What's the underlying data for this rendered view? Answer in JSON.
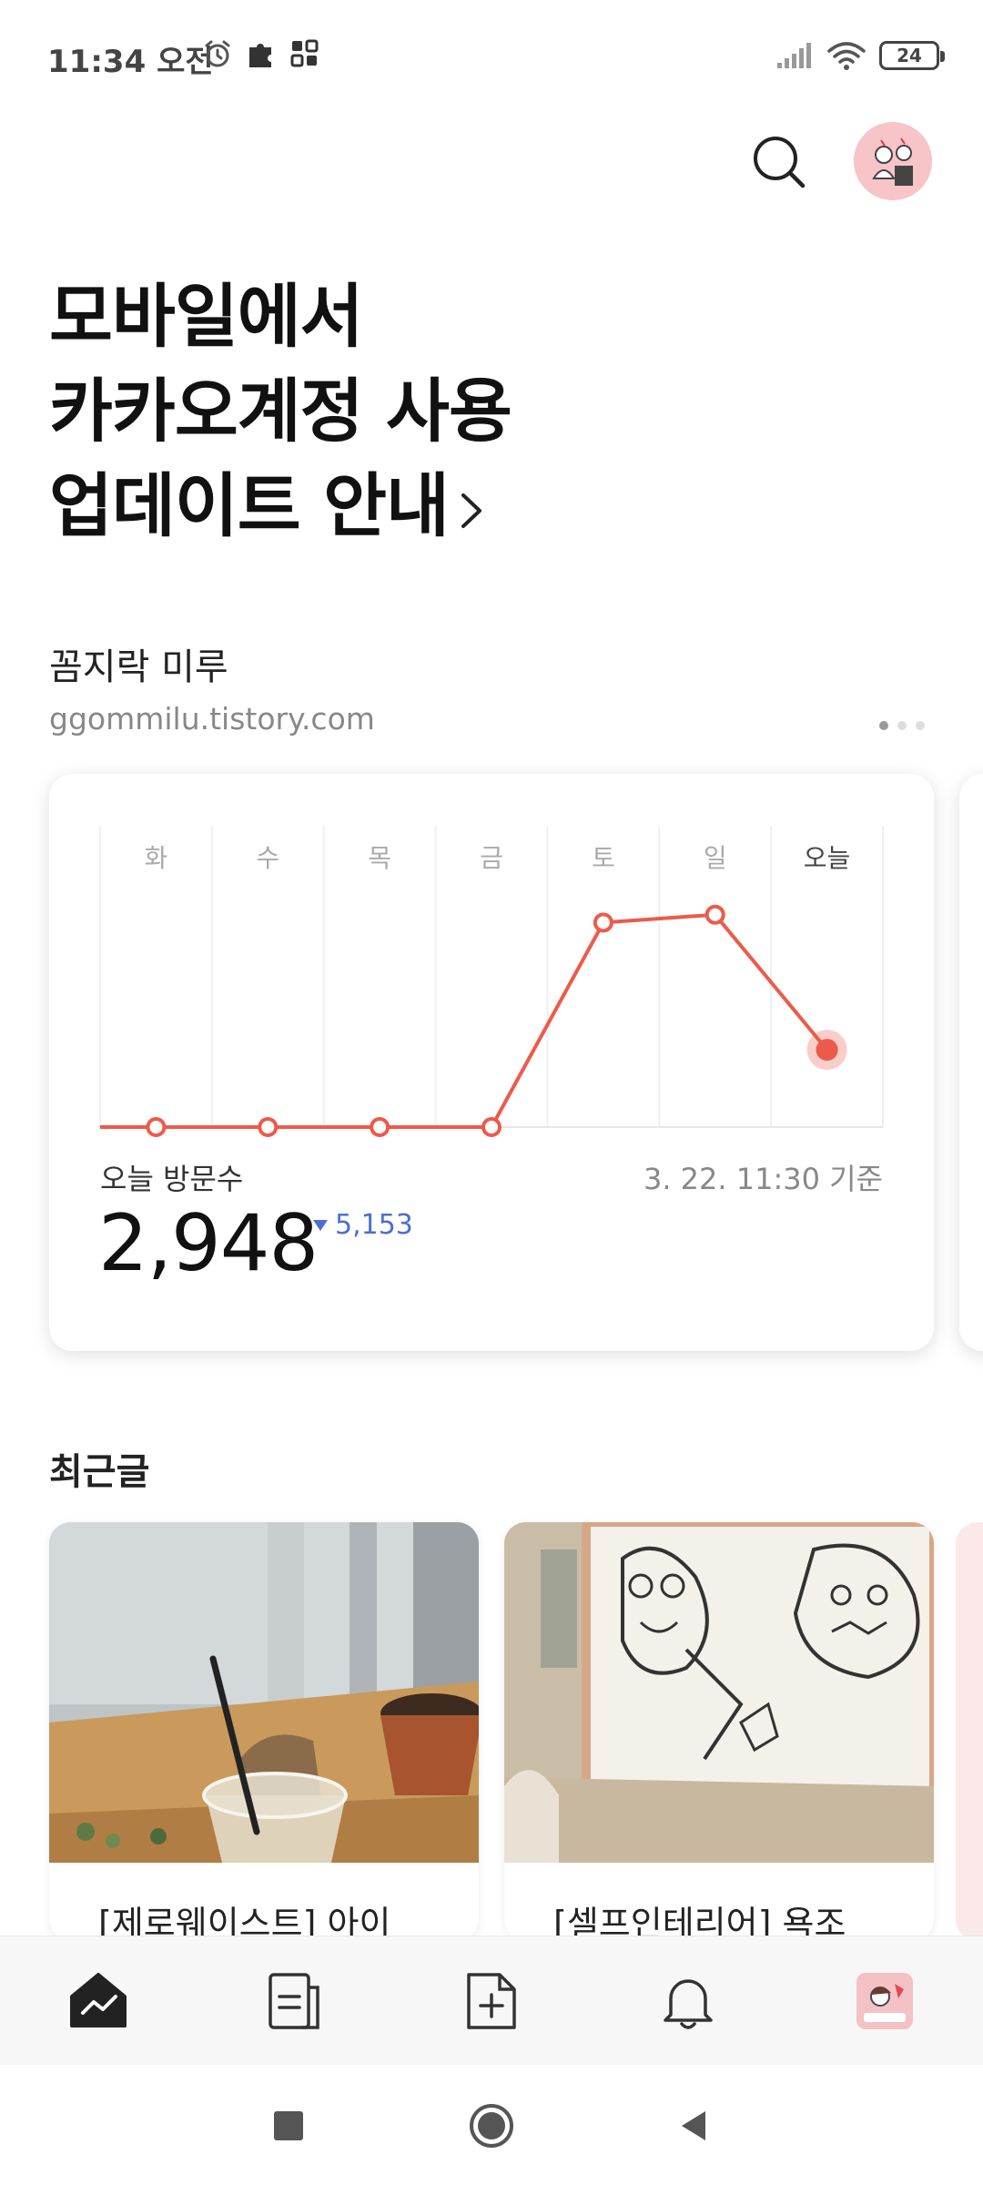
{
  "status_bar": {
    "time": "11:34 오전",
    "battery": "24"
  },
  "headline": {
    "line1": "모바일에서",
    "line2": "카카오계정 사용",
    "line3": "업데이트 안내"
  },
  "blog": {
    "name": "꼼지락 미루",
    "url": "ggommilu.tistory.com"
  },
  "stats": {
    "today_label": "오늘 방문수",
    "timestamp": "3. 22. 11:30 기준",
    "today_value": "2,948",
    "delta": "5,153",
    "delta_direction": "down",
    "delta_color": "#4a6fd3",
    "line_color": "#ec5b4a"
  },
  "chart_data": {
    "type": "line",
    "categories": [
      "화",
      "수",
      "목",
      "금",
      "토",
      "일",
      "오늘"
    ],
    "series": [
      {
        "values": [
          0,
          0,
          0,
          0,
          7800,
          8101,
          2948
        ]
      }
    ],
    "ylim": [
      0,
      10000
    ],
    "grid": true,
    "highlight_last": true
  },
  "recent": {
    "title": "최근글",
    "posts": [
      {
        "title": "[제로웨이스트] 아이"
      },
      {
        "title": "[셀프인테리어] 욕조"
      }
    ]
  },
  "icons": {
    "search": "search-icon",
    "nav": [
      "stats-icon",
      "posts-icon",
      "new-post-icon",
      "bell-icon",
      "profile-icon"
    ]
  }
}
